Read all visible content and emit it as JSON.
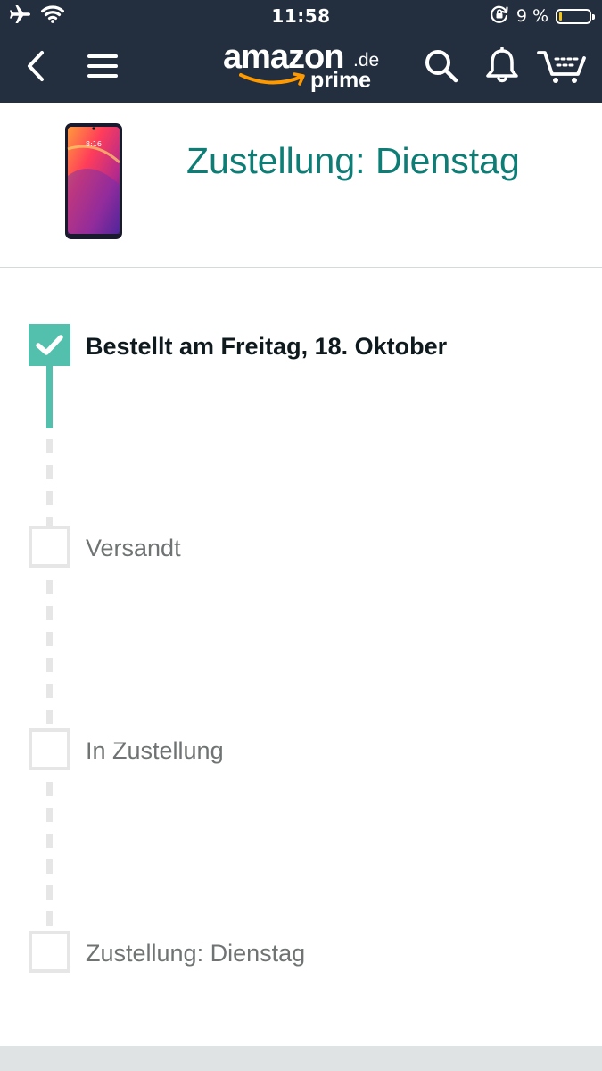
{
  "status_bar": {
    "time": "11:58",
    "battery_percent": "9 %",
    "battery_level": 0.09,
    "battery_color": "#f5c518"
  },
  "nav": {
    "back_icon": "chevron-left-icon",
    "menu_icon": "hamburger-menu-icon",
    "logo_text": "amazon",
    "logo_suffix": ".de",
    "logo_prime": "prime",
    "search_icon": "search-icon",
    "notifications_icon": "bell-icon",
    "cart_icon": "cart-icon",
    "background_color": "#232f3e"
  },
  "order": {
    "delivery_title": "Zustellung: Dienstag",
    "title_color": "#0d7d75",
    "product_image_icon": "smartphone-image"
  },
  "tracking": {
    "accent_color": "#52c0ac",
    "steps": [
      {
        "label": "Bestellt am Freitag, 18. Oktober",
        "done": true
      },
      {
        "label": "Versandt",
        "done": false
      },
      {
        "label": "In Zustellung",
        "done": false
      },
      {
        "label": "Zustellung: Dienstag",
        "done": false
      }
    ]
  }
}
